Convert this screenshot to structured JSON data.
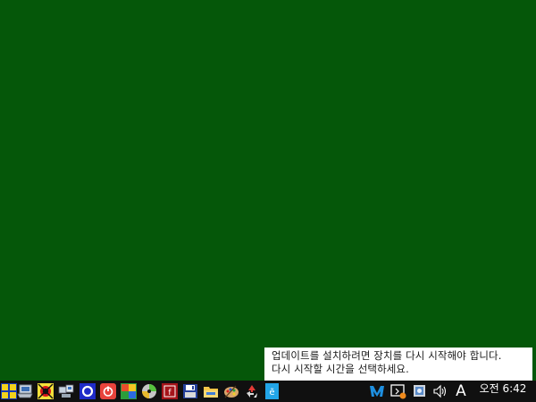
{
  "desktop": {
    "background_color": "#055709"
  },
  "notification": {
    "line1": "업데이트를 설치하려면 장치를 다시 시작해야 합니다.",
    "line2": "다시 시작할 시간을 선택하세요."
  },
  "taskbar": {
    "pinned_icons": [
      "start-icon",
      "computer-icon",
      "sports-icon",
      "network-icon",
      "circle-app-icon",
      "power-icon",
      "media-icon",
      "disc-icon",
      "flash-icon",
      "floppy-disk-icon",
      "folder-icon",
      "paint-palette-icon",
      "recycle-icon",
      "installer-icon"
    ]
  },
  "tray": {
    "icons": [
      "malwarebytes-icon",
      "action-center-icon",
      "update-icon",
      "volume-icon"
    ],
    "ime_indicator": "A",
    "clock": "오전 6:42"
  }
}
